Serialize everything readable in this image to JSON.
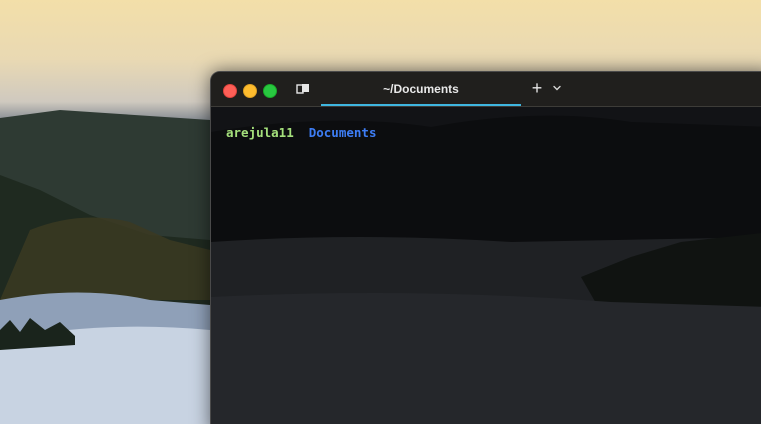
{
  "window": {
    "tab_title": "~/Documents",
    "new_tab_symbol": "+",
    "icons": {
      "close": "close-icon",
      "minimize": "minimize-icon",
      "maximize": "maximize-icon",
      "tab_overview": "tab-overview-icon",
      "new_tab": "plus-icon",
      "tab_menu": "chevron-down-icon"
    },
    "colors": {
      "accent_underline": "#3fb6e0",
      "prompt_user": "#a5e07c",
      "prompt_dir": "#3d7df5"
    }
  },
  "terminal": {
    "prompt_user": "arejula11",
    "prompt_dir": "Documents"
  }
}
